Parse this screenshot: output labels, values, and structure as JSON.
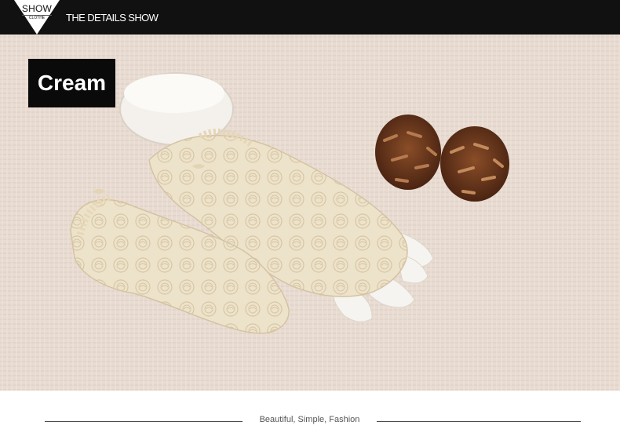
{
  "header": {
    "logo_word": "SHOW",
    "logo_subword": "CLOTHE",
    "title": "THE DETAILS SHOW"
  },
  "photo": {
    "color_label": "Cream"
  },
  "footer": {
    "tagline": "Beautiful, Simple, Fashion"
  },
  "colors": {
    "header_bg": "#111111",
    "background_fabric": "#e9dcd2",
    "glove_cream": "#ede3cc",
    "pinecone": "#6b3a1f"
  }
}
